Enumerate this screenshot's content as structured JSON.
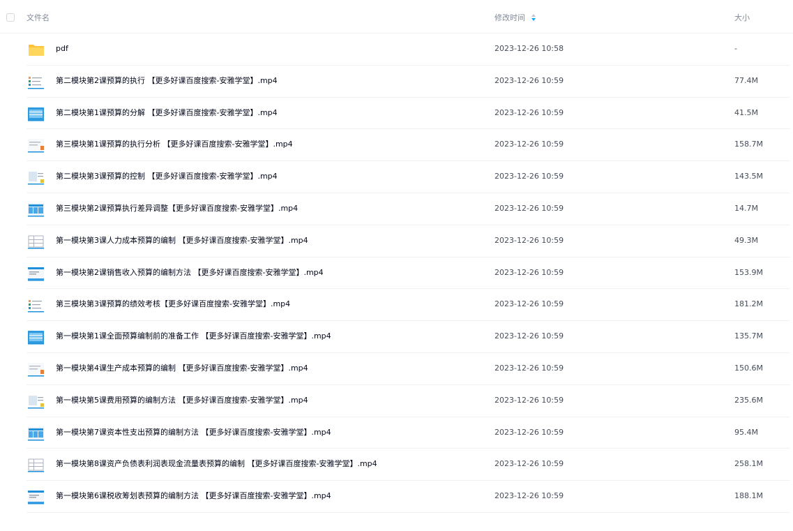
{
  "header": {
    "name_label": "文件名",
    "time_label": "修改时间",
    "size_label": "大小",
    "sort_icon": "sort-icon"
  },
  "accent_color": "#06a7ff",
  "files": [
    {
      "name": "pdf",
      "time": "2023-12-26 10:58",
      "size": "-",
      "icon": "folder-icon"
    },
    {
      "name": "第二模块第2课预算的执行 【更多好课百度搜索-安雅学堂】.mp4",
      "time": "2023-12-26 10:59",
      "size": "77.4M",
      "icon": "video-thumbnail-icon"
    },
    {
      "name": "第二模块第1课预算的分解 【更多好课百度搜索-安雅学堂】.mp4",
      "time": "2023-12-26 10:59",
      "size": "41.5M",
      "icon": "video-thumbnail-icon"
    },
    {
      "name": "第三模块第1课预算的执行分析 【更多好课百度搜索-安雅学堂】.mp4",
      "time": "2023-12-26 10:59",
      "size": "158.7M",
      "icon": "video-thumbnail-icon"
    },
    {
      "name": "第二模块第3课预算的控制 【更多好课百度搜索-安雅学堂】.mp4",
      "time": "2023-12-26 10:59",
      "size": "143.5M",
      "icon": "video-thumbnail-icon"
    },
    {
      "name": "第三模块第2课预算执行差异调整【更多好课百度搜索-安雅学堂】.mp4",
      "time": "2023-12-26 10:59",
      "size": "14.7M",
      "icon": "video-thumbnail-icon"
    },
    {
      "name": "第一模块第3课人力成本预算的编制 【更多好课百度搜索-安雅学堂】.mp4",
      "time": "2023-12-26 10:59",
      "size": "49.3M",
      "icon": "video-thumbnail-icon"
    },
    {
      "name": "第一模块第2课销售收入预算的编制方法 【更多好课百度搜索-安雅学堂】.mp4",
      "time": "2023-12-26 10:59",
      "size": "153.9M",
      "icon": "video-thumbnail-icon"
    },
    {
      "name": "第三模块第3课预算的绩效考核【更多好课百度搜索-安雅学堂】.mp4",
      "time": "2023-12-26 10:59",
      "size": "181.2M",
      "icon": "video-thumbnail-icon"
    },
    {
      "name": "第一模块第1课全面预算编制前的准备工作 【更多好课百度搜索-安雅学堂】.mp4",
      "time": "2023-12-26 10:59",
      "size": "135.7M",
      "icon": "video-thumbnail-icon"
    },
    {
      "name": "第一模块第4课生产成本预算的编制 【更多好课百度搜索-安雅学堂】.mp4",
      "time": "2023-12-26 10:59",
      "size": "150.6M",
      "icon": "video-thumbnail-icon"
    },
    {
      "name": "第一模块第5课费用预算的编制方法 【更多好课百度搜索-安雅学堂】.mp4",
      "time": "2023-12-26 10:59",
      "size": "235.6M",
      "icon": "video-thumbnail-icon"
    },
    {
      "name": "第一模块第7课资本性支出预算的编制方法 【更多好课百度搜索-安雅学堂】.mp4",
      "time": "2023-12-26 10:59",
      "size": "95.4M",
      "icon": "video-thumbnail-icon"
    },
    {
      "name": "第一模块第8课资产负债表利润表现金流量表预算的编制 【更多好课百度搜索-安雅学堂】.mp4",
      "time": "2023-12-26 10:59",
      "size": "258.1M",
      "icon": "video-thumbnail-icon"
    },
    {
      "name": "第一模块第6课税收筹划表预算的编制方法 【更多好课百度搜索-安雅学堂】.mp4",
      "time": "2023-12-26 10:59",
      "size": "188.1M",
      "icon": "video-thumbnail-icon"
    }
  ]
}
